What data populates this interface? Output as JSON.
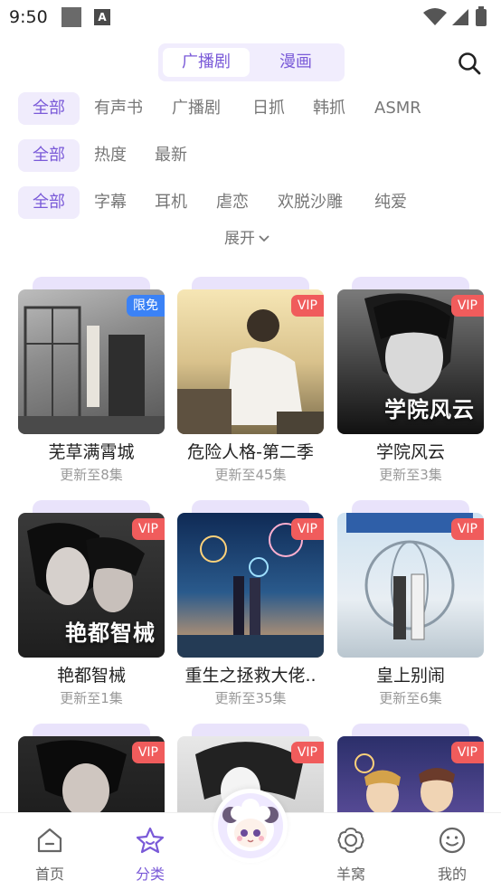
{
  "status_bar": {
    "time": "9:50",
    "small_icon_letter": "A"
  },
  "top_tabs": [
    {
      "label": "广播剧",
      "active": true
    },
    {
      "label": "漫画",
      "active": false
    }
  ],
  "filters": {
    "row1": [
      "全部",
      "有声书",
      "广播剧",
      "日抓",
      "韩抓",
      "ASMR"
    ],
    "row2": [
      "全部",
      "热度",
      "最新"
    ],
    "row3": [
      "全部",
      "字幕",
      "耳机",
      "虐恋",
      "欢脱沙雕",
      "纯爱"
    ],
    "expand_label": "展开"
  },
  "cards": [
    {
      "title": "芜草满霄城",
      "subtitle": "更新至8集",
      "badge": "限免",
      "cover_text": ""
    },
    {
      "title": "危险人格-第二季",
      "subtitle": "更新至45集",
      "badge": "VIP",
      "cover_text": ""
    },
    {
      "title": "学院风云",
      "subtitle": "更新至3集",
      "badge": "VIP",
      "cover_text": "学院风云"
    },
    {
      "title": "艳都智械",
      "subtitle": "更新至1集",
      "badge": "VIP",
      "cover_text": "艳都智械"
    },
    {
      "title": "重生之拯救大佬..",
      "subtitle": "更新至35集",
      "badge": "VIP",
      "cover_text": ""
    },
    {
      "title": "皇上别闹",
      "subtitle": "更新至6集",
      "badge": "VIP",
      "cover_text": ""
    },
    {
      "title": "",
      "subtitle": "",
      "badge": "VIP",
      "cover_text": ""
    },
    {
      "title": "",
      "subtitle": "",
      "badge": "VIP",
      "cover_text": ""
    },
    {
      "title": "",
      "subtitle": "",
      "badge": "VIP",
      "cover_text": ""
    }
  ],
  "bottom_nav": [
    {
      "label": "首页",
      "icon": "home-icon",
      "active": false
    },
    {
      "label": "分类",
      "icon": "category-star-icon",
      "active": true
    },
    {
      "label": "",
      "icon": "mascot-avatar",
      "active": false
    },
    {
      "label": "羊窝",
      "icon": "flower-icon",
      "active": false
    },
    {
      "label": "我的",
      "icon": "smiley-icon",
      "active": false
    }
  ],
  "colors": {
    "accent": "#7a5ad8",
    "accent_bg": "#f0ecfc",
    "vip_badge": "#f05c5c",
    "free_badge": "#3b82f6"
  }
}
